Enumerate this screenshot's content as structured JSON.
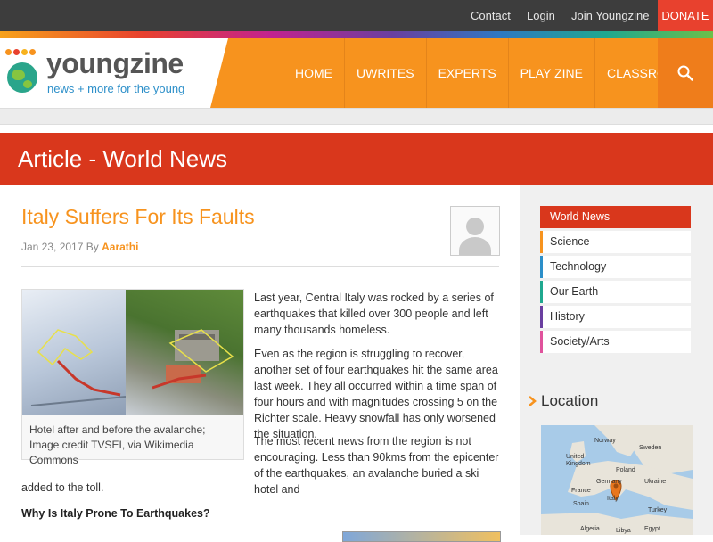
{
  "topbar": {
    "links": [
      "Contact",
      "Login",
      "Join Youngzine"
    ],
    "donate": "DONATE"
  },
  "logo": {
    "name": "youngzine",
    "tagline": "news + more for the young"
  },
  "nav": {
    "items": [
      "HOME",
      "UWRITES",
      "EXPERTS",
      "PLAY ZINE",
      "CLASSROOM"
    ],
    "search_icon": "search-icon"
  },
  "banner": {
    "title": "Article - World News"
  },
  "article": {
    "title": "Italy Suffers For Its Faults",
    "date": "Jan 23, 2017",
    "by": "By",
    "author": "Aarathi",
    "image_caption": "Hotel after and before the avalanche; Image credit TVSEI, via Wikimedia Commons",
    "paragraphs": [
      "Last year, Central Italy was rocked by a series of earthquakes that killed over 300 people and left many thousands homeless.",
      "Even as the region is struggling to recover, another set of four earthquakes hit the same area last week. They all occurred within a time span of four hours and with magnitudes crossing 5 on the Richter scale. Heavy snowfall has only worsened the situation.",
      "The most recent news from the region is not encouraging. Less than 90kms from the epicenter of the earthquakes, an avalanche buried a ski hotel and",
      "added to the toll."
    ],
    "subheading": "Why Is Italy Prone To Earthquakes?"
  },
  "sidebar": {
    "categories": [
      {
        "label": "World News",
        "color": "#d9371c"
      },
      {
        "label": "Science",
        "color": "#f7931e"
      },
      {
        "label": "Technology",
        "color": "#2c8fc9"
      },
      {
        "label": "Our Earth",
        "color": "#1fa88f"
      },
      {
        "label": "History",
        "color": "#6a3fa0"
      },
      {
        "label": "Society/Arts",
        "color": "#e0529c"
      }
    ],
    "location_title": "Location",
    "map_labels": [
      "Norway",
      "Sweden",
      "United Kingdom",
      "Germany",
      "Poland",
      "France",
      "Ukraine",
      "Spain",
      "Italy",
      "Turkey",
      "Algeria",
      "Libya",
      "Egypt"
    ]
  },
  "colors": {
    "orange": "#f7931e",
    "red": "#d9371c",
    "donate": "#e8412e",
    "dark": "#3d3d3d"
  }
}
